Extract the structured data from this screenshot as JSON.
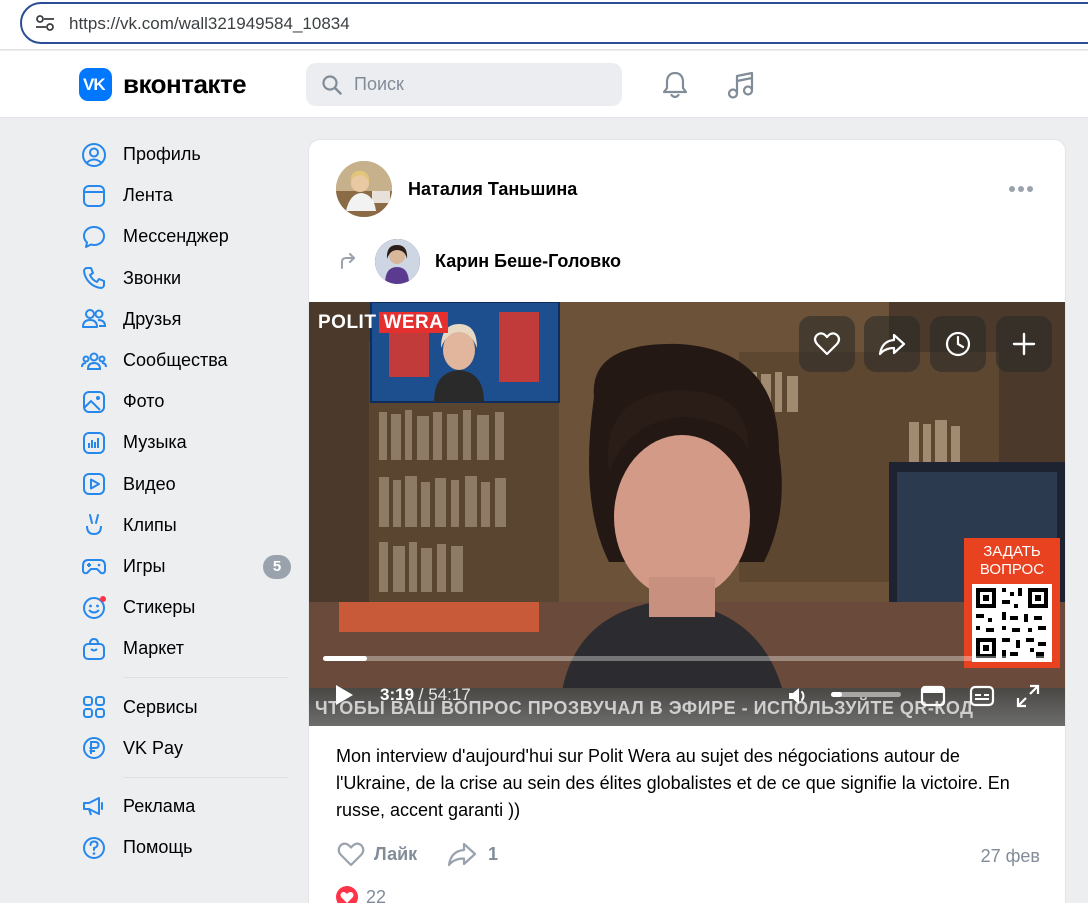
{
  "browser": {
    "url": "https://vk.com/wall321949584_10834"
  },
  "header": {
    "logo_text": "вконтакте",
    "logo_mark": "VK",
    "search_placeholder": "Поиск",
    "accent_color": "#0077ff"
  },
  "sidebar": {
    "items": [
      {
        "label": "Профиль",
        "icon": "user-circle-icon"
      },
      {
        "label": "Лента",
        "icon": "news-icon"
      },
      {
        "label": "Мессенджер",
        "icon": "message-icon"
      },
      {
        "label": "Звонки",
        "icon": "phone-icon"
      },
      {
        "label": "Друзья",
        "icon": "friends-icon"
      },
      {
        "label": "Сообщества",
        "icon": "communities-icon"
      },
      {
        "label": "Фото",
        "icon": "photo-icon"
      },
      {
        "label": "Музыка",
        "icon": "music-icon"
      },
      {
        "label": "Видео",
        "icon": "video-icon"
      },
      {
        "label": "Клипы",
        "icon": "clips-icon"
      },
      {
        "label": "Игры",
        "icon": "gamepad-icon",
        "badge": "5"
      },
      {
        "label": "Стикеры",
        "icon": "sticker-icon"
      },
      {
        "label": "Маркет",
        "icon": "market-icon"
      },
      {
        "label": "Сервисы",
        "icon": "services-icon"
      },
      {
        "label": "VK Pay",
        "icon": "vkpay-icon"
      },
      {
        "label": "Реклама",
        "icon": "ads-icon"
      },
      {
        "label": "Помощь",
        "icon": "help-icon"
      }
    ]
  },
  "post": {
    "author": "Наталия Таньшина",
    "repost_author": "Карин Беше-Головко",
    "video": {
      "brand_a": "POLIT",
      "brand_b": "WERA",
      "ask_label": "ЗАДАТЬ ВОПРОС",
      "ticker": "ЧТОБЫ ВАШ ВОПРОС ПРОЗВУЧАЛ В ЭФИРЕ - ИСПОЛЬЗУЙТЕ QR-КОД",
      "current_time": "3:19",
      "total_time": "/ 54:17",
      "progress_fraction": 0.061,
      "volume_fraction": 0.15
    },
    "text": "Mon interview d'aujourd'hui sur Polit Wera au sujet des négociations autour de l'Ukraine, de la crise au sein des élites globalistes et de ce que signifie la victoire. En russe, accent garanti ))",
    "like_label": "Лайк",
    "share_count": "1",
    "date": "27 фев",
    "reactions_count": "22"
  }
}
